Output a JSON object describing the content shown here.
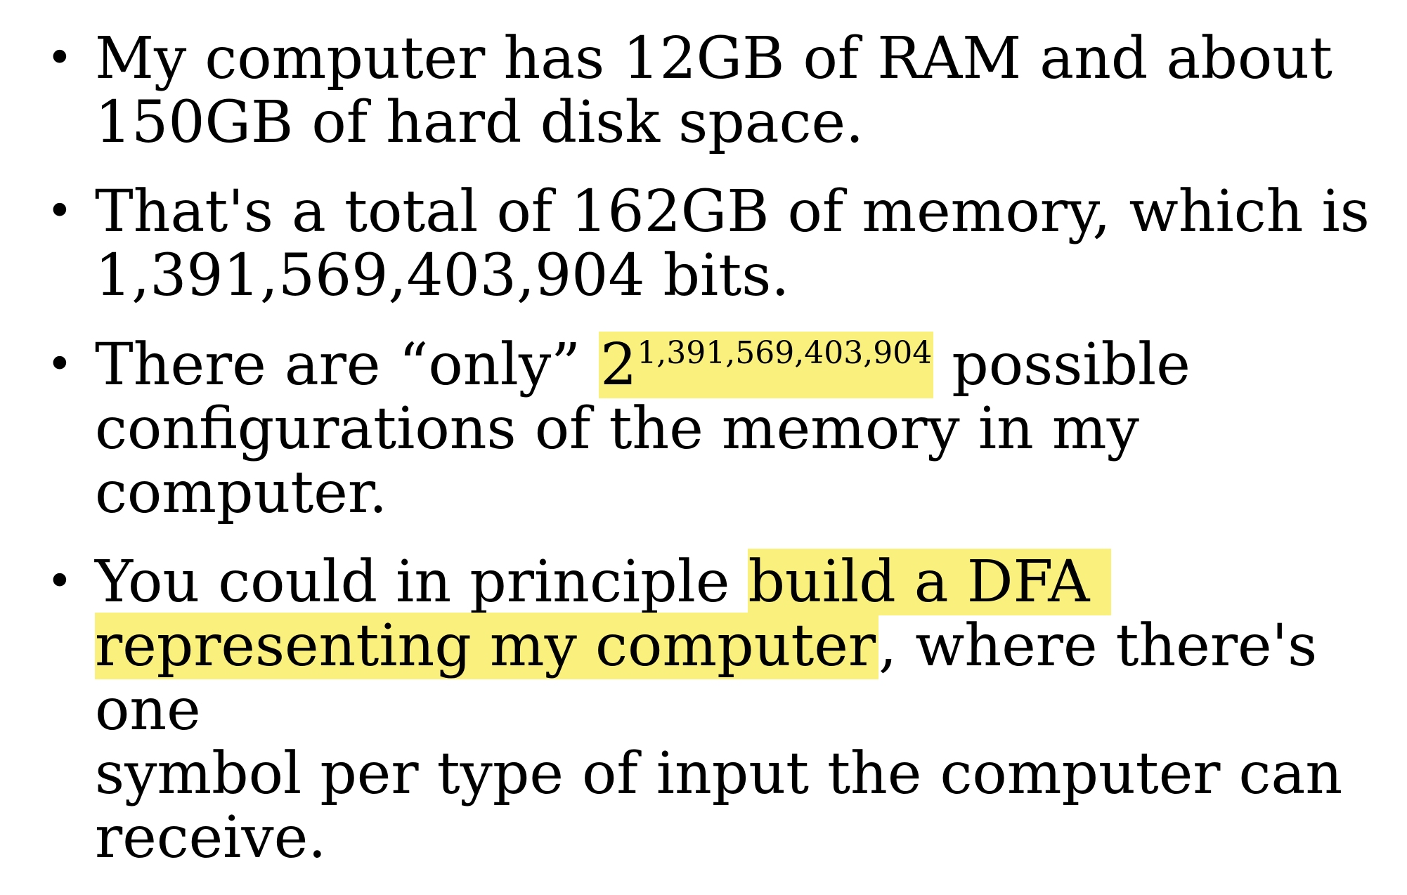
{
  "bullets": [
    {
      "lines": [
        "My computer has 12GB of RAM and about",
        "150GB of hard disk space."
      ]
    },
    {
      "lines": [
        "That's a total of 162GB of memory, which is",
        "1,391,569,403,904 bits."
      ]
    },
    {
      "prefix": "There are “only” ",
      "base": "2",
      "exponent": "1,391,569,403,904",
      "suffix": " possible",
      "rest_lines": [
        "configurations of the memory in my",
        "computer."
      ]
    },
    {
      "prefix": "You could in principle ",
      "highlight_line1": "build a DFA ",
      "highlight_line2": "representing my computer",
      "after_highlight": ", where there's one",
      "rest_lines": [
        "symbol per type of input the computer can",
        "receive."
      ]
    }
  ],
  "highlight_color": "#faf07e",
  "bullet_glyph": "•"
}
